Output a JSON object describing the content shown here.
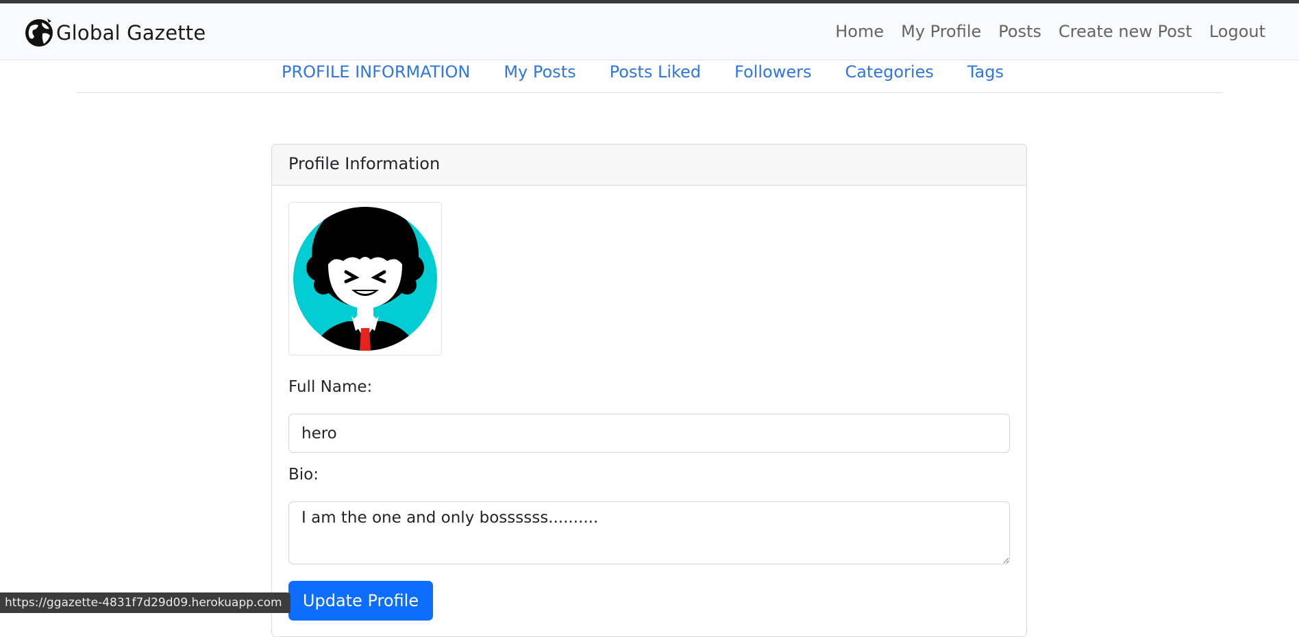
{
  "brand": {
    "name": "Global Gazette"
  },
  "nav": {
    "items": [
      {
        "label": "Home"
      },
      {
        "label": "My Profile"
      },
      {
        "label": "Posts"
      },
      {
        "label": "Create new Post"
      },
      {
        "label": "Logout"
      }
    ]
  },
  "subnav": {
    "items": [
      {
        "label": "PROFILE INFORMATION"
      },
      {
        "label": "My Posts"
      },
      {
        "label": "Posts Liked"
      },
      {
        "label": "Followers"
      },
      {
        "label": "Categories"
      },
      {
        "label": "Tags"
      }
    ]
  },
  "card": {
    "title": "Profile Information",
    "full_name_label": "Full Name:",
    "full_name_value": "hero",
    "bio_label": "Bio:",
    "bio_value": "I am the one and only bossssss..........",
    "update_button": "Update Profile"
  },
  "status_bar": {
    "url": "https://ggazette-4831f7d29d09.herokuapp.com"
  },
  "colors": {
    "link": "#2f76e0",
    "primary_button": "#0d6efd",
    "avatar_bg": "#00ccd3"
  },
  "icons": {
    "brand_logo": "globe-icon",
    "avatar": "user-avatar-image"
  }
}
